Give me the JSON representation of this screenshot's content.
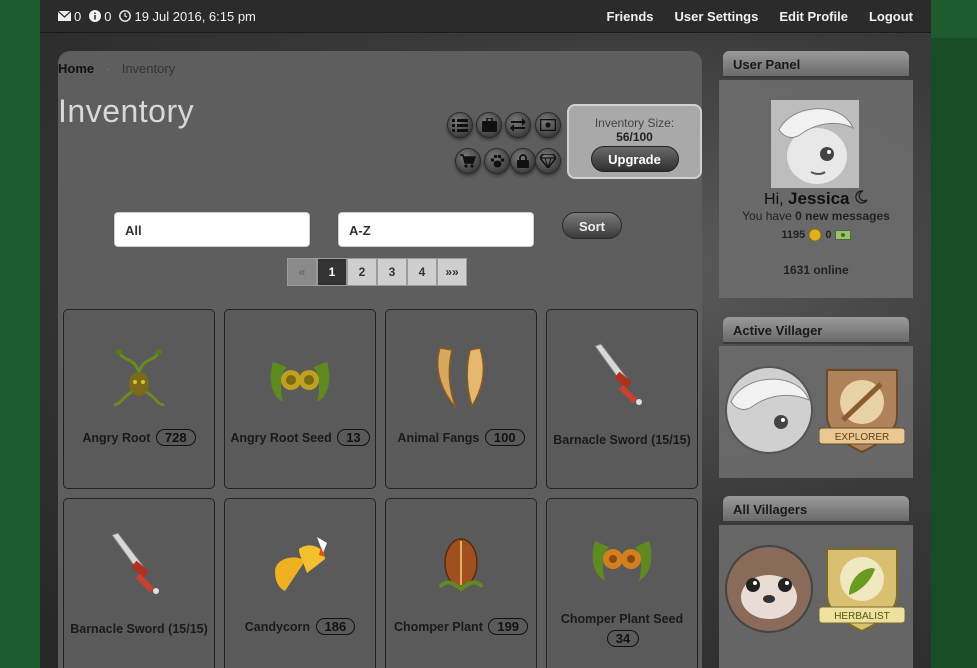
{
  "topbar": {
    "mail_count": "0",
    "alert_count": "0",
    "datetime": "19 Jul 2016, 6:15 pm",
    "links": [
      "Friends",
      "User Settings",
      "Edit Profile",
      "Logout"
    ]
  },
  "breadcrumb": {
    "home": "Home",
    "current": "Inventory"
  },
  "page_title": "Inventory",
  "toolbar_icons": [
    "list-icon",
    "briefcase-icon",
    "swap-icon",
    "money-icon",
    "cart-icon",
    "paw-icon",
    "lock-icon",
    "diamond-icon"
  ],
  "inventory_size": {
    "label": "Inventory Size:",
    "value": "56/100",
    "upgrade_label": "Upgrade"
  },
  "filters": {
    "category": "All",
    "order": "A-Z",
    "sort_label": "Sort"
  },
  "pagination": {
    "prev": "«",
    "pages": [
      "1",
      "2",
      "3",
      "4"
    ],
    "next": "»»",
    "current": "1"
  },
  "items": [
    {
      "name": "Angry Root",
      "qty": "728"
    },
    {
      "name": "Angry Root Seed",
      "qty": "13"
    },
    {
      "name": "Animal Fangs",
      "qty": "100"
    },
    {
      "name": "Barnacle Sword (15/15)",
      "qty": ""
    },
    {
      "name": "Barnacle Sword (15/15)",
      "qty": ""
    },
    {
      "name": "Candycorn",
      "qty": "186"
    },
    {
      "name": "Chomper Plant",
      "qty": "199"
    },
    {
      "name": "Chomper Plant Seed",
      "qty": "34"
    }
  ],
  "sidebar": {
    "user_panel": {
      "title": "User Panel",
      "greeting": "Hi,",
      "username": "Jessica",
      "messages_prefix": "You have",
      "messages_count": "0 new messages",
      "coins": "1195",
      "cash": "0",
      "online": "1631 online"
    },
    "active_villager": {
      "title": "Active Villager",
      "badge": "EXPLORER"
    },
    "all_villagers": {
      "title": "All Villagers",
      "badge": "HERBALIST"
    }
  },
  "colors": {
    "background_green": "#1e5c2d",
    "panel_gray": "#5e5e5e",
    "topbar": "#2b2b2b"
  }
}
